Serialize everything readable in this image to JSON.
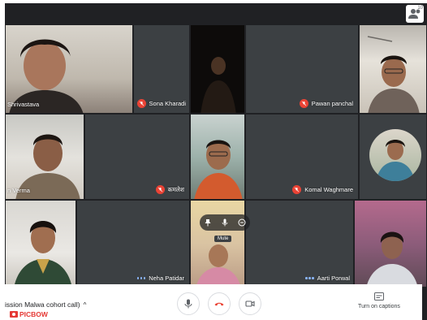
{
  "people": {
    "count": "10"
  },
  "participants": [
    {
      "name": "Shrivastava",
      "status": "none"
    },
    {
      "name": "Sona Kharadi",
      "status": "muted"
    },
    {
      "name": "",
      "status": "none"
    },
    {
      "name": "Pawan panchal",
      "status": "muted"
    },
    {
      "name": "",
      "status": "none"
    },
    {
      "name": "n Verma",
      "status": "none"
    },
    {
      "name": "कमलेश",
      "status": "muted"
    },
    {
      "name": "",
      "status": "none"
    },
    {
      "name": "Komal Waghmare",
      "status": "muted"
    },
    {
      "name": "",
      "status": "none"
    },
    {
      "name": "Neha Patidar",
      "status": "speaking"
    },
    {
      "name": "",
      "status": "none"
    },
    {
      "name": "Aarti Porwal",
      "status": "speaking"
    },
    {
      "name": "",
      "status": "none"
    }
  ],
  "tile_hover": {
    "mute_tooltip": "Mute"
  },
  "bottom_bar": {
    "meeting_title": "ission Malwa cohort call)",
    "captions_label": "Turn on captions"
  },
  "watermark": {
    "text": "PICBOW"
  },
  "icons": {
    "people": "people-icon",
    "mute": "mic-off-icon",
    "speaking": "audio-wave-icon",
    "pin": "pin-icon",
    "mic": "mic-icon",
    "remove": "remove-icon",
    "end_call": "phone-hangup-icon",
    "camera": "camera-icon",
    "captions": "captions-icon",
    "caret": "chevron-up-icon"
  },
  "colors": {
    "background": "#202124",
    "tile": "#3c4043",
    "mute_badge": "#ea4335",
    "speaking": "#8ab4f8",
    "end_call": "#ea4335",
    "watermark": "#e53935"
  }
}
